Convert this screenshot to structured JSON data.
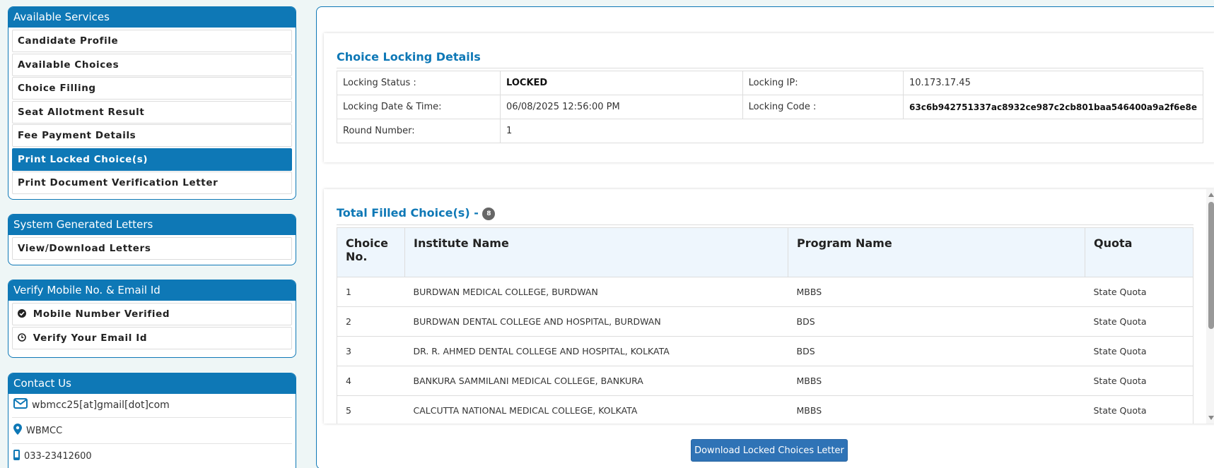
{
  "sidebar": {
    "services": {
      "title": "Available Services",
      "items": [
        {
          "label": "Candidate Profile"
        },
        {
          "label": "Available Choices"
        },
        {
          "label": "Choice Filling"
        },
        {
          "label": "Seat Allotment Result"
        },
        {
          "label": "Fee Payment Details"
        },
        {
          "label": "Print Locked Choice(s)",
          "active": true
        },
        {
          "label": "Print Document Verification Letter"
        }
      ]
    },
    "letters": {
      "title": "System Generated Letters",
      "items": [
        {
          "label": "View/Download Letters"
        }
      ]
    },
    "verify": {
      "title": "Verify Mobile No. & Email Id",
      "items": [
        {
          "label": "Mobile Number Verified",
          "icon": "check-circle-icon"
        },
        {
          "label": "Verify Your Email Id",
          "icon": "clock-icon"
        }
      ]
    },
    "contact": {
      "title": "Contact Us",
      "email": "wbmcc25[at]gmail[dot]com",
      "location": "WBMCC",
      "phone": "033-23412600"
    }
  },
  "locking": {
    "title": "Choice Locking Details",
    "status_label": "Locking Status :",
    "status_value": "LOCKED",
    "ip_label": "Locking IP:",
    "ip_value": "10.173.17.45",
    "datetime_label": "Locking Date & Time:",
    "datetime_value": "06/08/2025 12:56:00 PM",
    "code_label": "Locking Code :",
    "code_value": "63c6b942751337ac8932ce987c2cb801baa546400a9a2f6e8e",
    "round_label": "Round Number:",
    "round_value": "1"
  },
  "choices": {
    "title": "Total Filled Choice(s) -",
    "count": "8",
    "headers": [
      "Choice No.",
      "Institute Name",
      "Program Name",
      "Quota"
    ],
    "rows": [
      {
        "no": "1",
        "institute": "BURDWAN MEDICAL COLLEGE, BURDWAN",
        "program": "MBBS",
        "quota": "State Quota"
      },
      {
        "no": "2",
        "institute": "BURDWAN DENTAL COLLEGE AND HOSPITAL, BURDWAN",
        "program": "BDS",
        "quota": "State Quota"
      },
      {
        "no": "3",
        "institute": "DR. R. AHMED DENTAL COLLEGE AND HOSPITAL, KOLKATA",
        "program": "BDS",
        "quota": "State Quota"
      },
      {
        "no": "4",
        "institute": "BANKURA SAMMILANI MEDICAL COLLEGE, BANKURA",
        "program": "MBBS",
        "quota": "State Quota"
      },
      {
        "no": "5",
        "institute": "CALCUTTA NATIONAL MEDICAL COLLEGE, KOLKATA",
        "program": "MBBS",
        "quota": "State Quota"
      }
    ]
  },
  "download_button": "Download Locked Choices Letter",
  "colors": {
    "primary": "#0e78b6",
    "button": "#2f73b6",
    "header_bg": "#eef6fd"
  }
}
